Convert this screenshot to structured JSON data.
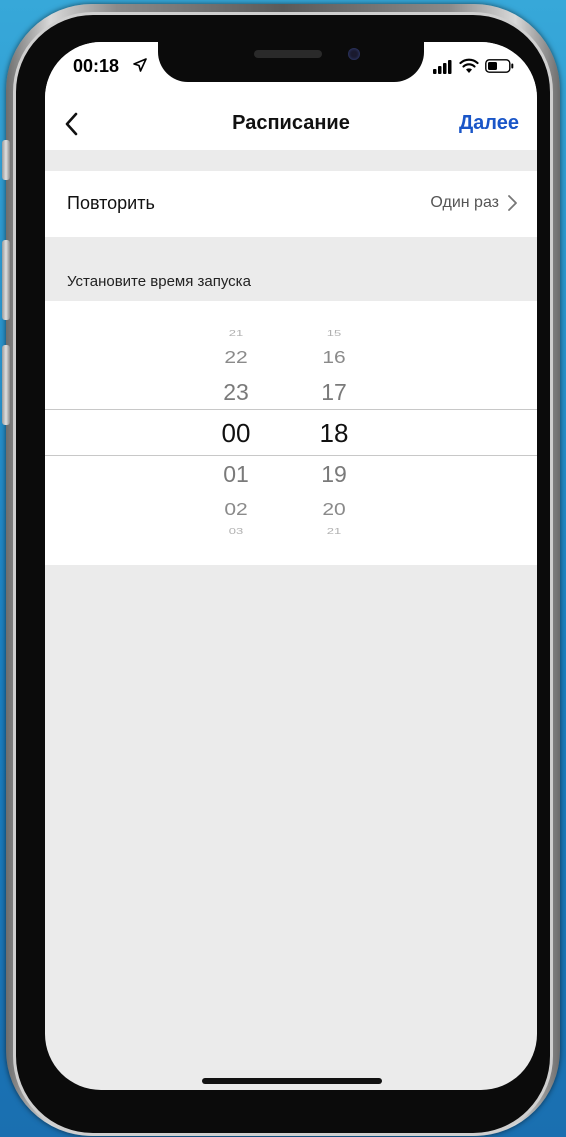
{
  "status_bar": {
    "time": "00:18"
  },
  "nav": {
    "title": "Расписание",
    "next_label": "Далее"
  },
  "repeat": {
    "label": "Повторить",
    "value": "Один раз"
  },
  "section": {
    "header": "Установите время запуска"
  },
  "picker": {
    "hours": [
      "21",
      "22",
      "23",
      "00",
      "01",
      "02",
      "03"
    ],
    "minutes": [
      "15",
      "16",
      "17",
      "18",
      "19",
      "20",
      "21"
    ],
    "selected_hour": "00",
    "selected_minute": "18"
  },
  "colors": {
    "accent": "#1a56c8",
    "background": "#ebebeb"
  }
}
